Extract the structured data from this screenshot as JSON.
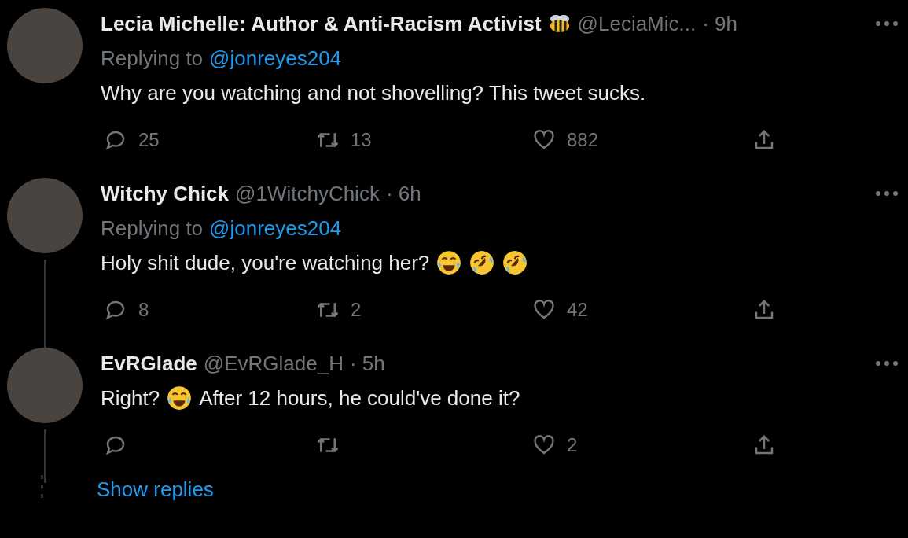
{
  "tweets": [
    {
      "name": "Lecia Michelle: Author & Anti-Racism Activist",
      "bee_badge": true,
      "handle": "@LeciaMic...",
      "time": "· 9h",
      "replying_label": "Replying to",
      "replying_to": "@jonreyes204",
      "thread_line": false,
      "text": [
        {
          "kind": "text",
          "text": "Why are you watching and not shovelling? This tweet sucks."
        }
      ],
      "replies": "25",
      "retweets": "13",
      "likes": "882"
    },
    {
      "name": "Witchy Chick",
      "handle": "@1WitchyChick",
      "time": "· 6h",
      "replying_label": "Replying to",
      "replying_to": "@jonreyes204",
      "thread_line": true,
      "text": [
        {
          "kind": "text",
          "text": "Holy shit dude, you're watching her?"
        },
        {
          "kind": "tears"
        },
        {
          "kind": "rofl"
        },
        {
          "kind": "rofl"
        }
      ],
      "replies": "8",
      "retweets": "2",
      "likes": "42"
    },
    {
      "name": "EvRGlade",
      "handle": "@EvRGlade_H",
      "time": "· 5h",
      "thread_line": true,
      "text": [
        {
          "kind": "text",
          "text": "Right?"
        },
        {
          "kind": "tears"
        },
        {
          "kind": "text",
          "text": "After 12 hours, he could've done it?"
        }
      ],
      "likes": "2"
    }
  ],
  "show_replies": "Show replies"
}
